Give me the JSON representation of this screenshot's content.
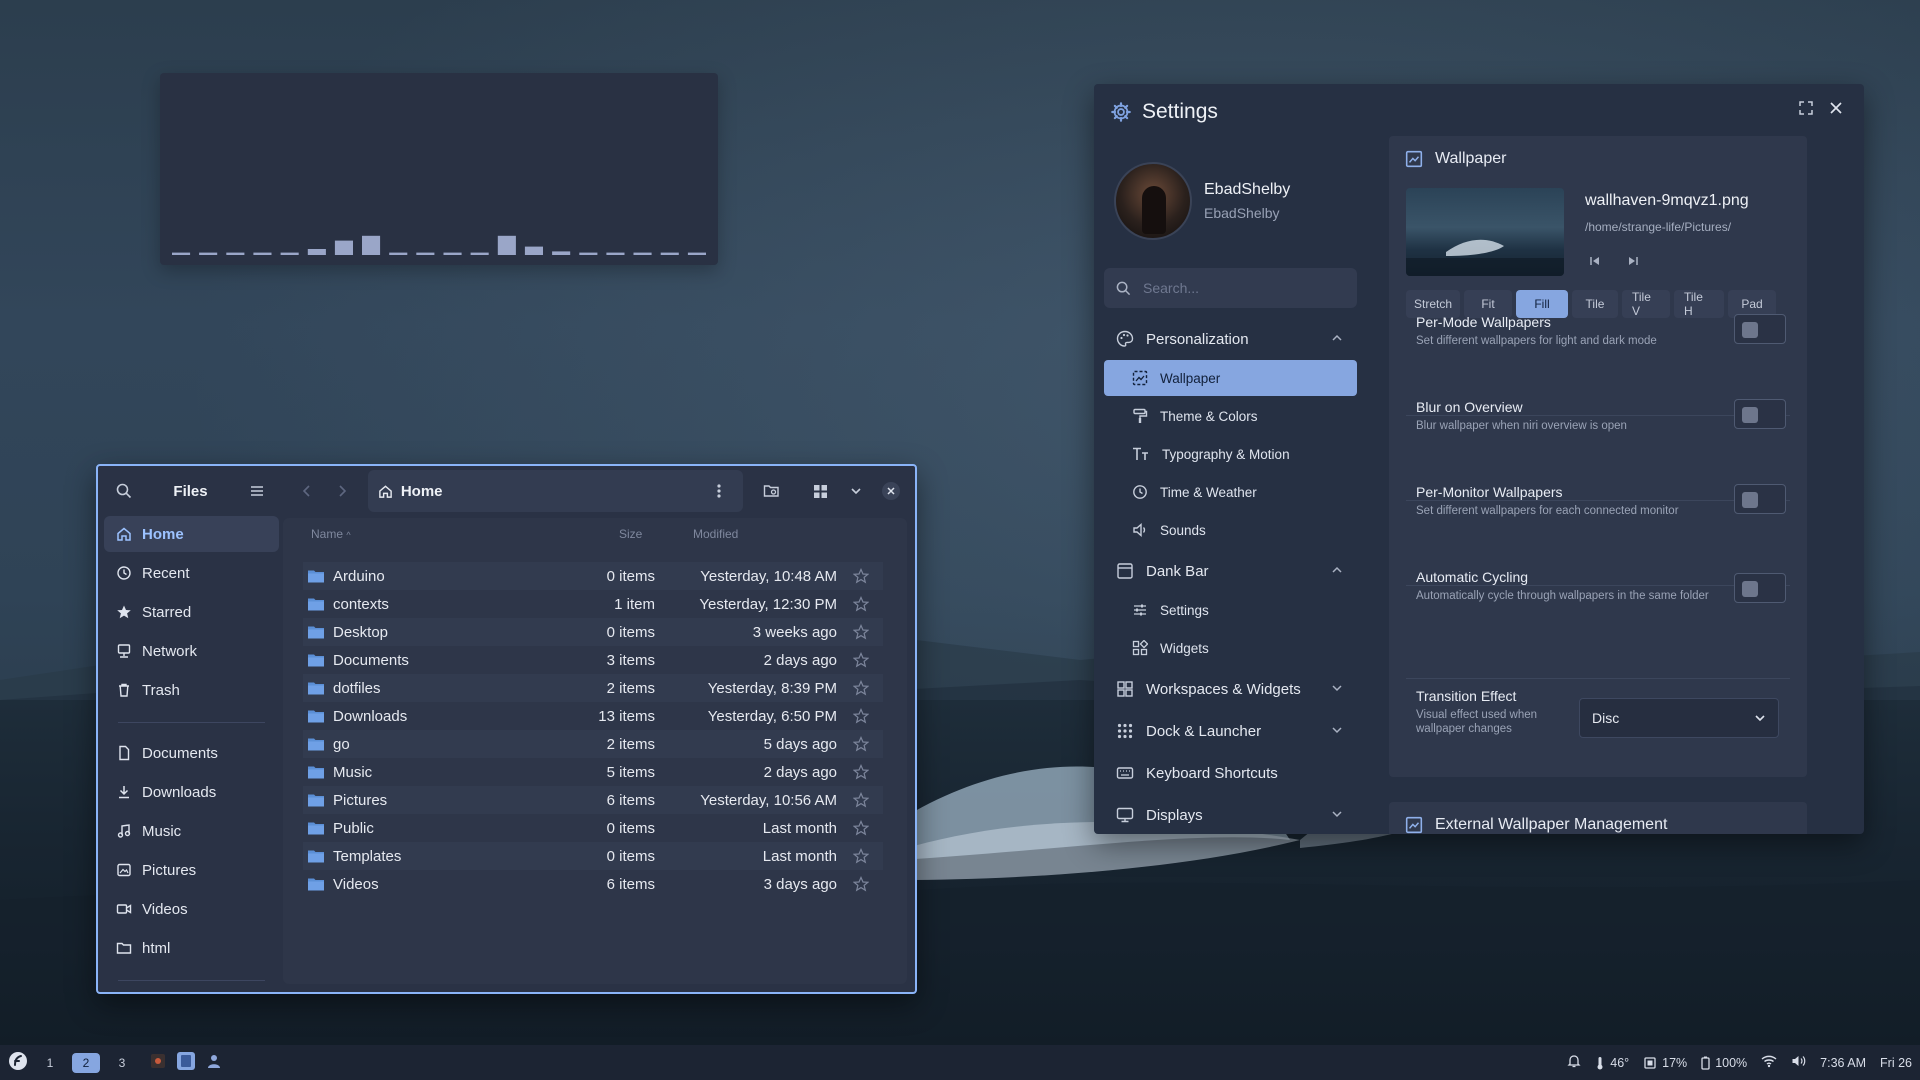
{
  "files": {
    "title": "Files",
    "path": "Home",
    "columns": {
      "name": "Name",
      "size": "Size",
      "modified": "Modified"
    },
    "sidebar": [
      {
        "label": "Home",
        "icon": "home-icon",
        "active": true
      },
      {
        "label": "Recent",
        "icon": "clock-icon"
      },
      {
        "label": "Starred",
        "icon": "star-icon"
      },
      {
        "label": "Network",
        "icon": "network-icon"
      },
      {
        "label": "Trash",
        "icon": "trash-icon"
      }
    ],
    "bookmarks": [
      {
        "label": "Documents",
        "icon": "document-icon"
      },
      {
        "label": "Downloads",
        "icon": "download-icon"
      },
      {
        "label": "Music",
        "icon": "music-icon"
      },
      {
        "label": "Pictures",
        "icon": "picture-icon"
      },
      {
        "label": "Videos",
        "icon": "video-icon"
      },
      {
        "label": "html",
        "icon": "folder-icon"
      }
    ],
    "rows": [
      {
        "name": "Arduino",
        "size": "0 items",
        "modified": "Yesterday, 10:48 AM"
      },
      {
        "name": "contexts",
        "size": "1 item",
        "modified": "Yesterday, 12:30 PM"
      },
      {
        "name": "Desktop",
        "size": "0 items",
        "modified": "3 weeks ago"
      },
      {
        "name": "Documents",
        "size": "3 items",
        "modified": "2 days ago"
      },
      {
        "name": "dotfiles",
        "size": "2 items",
        "modified": "Yesterday, 8:39 PM"
      },
      {
        "name": "Downloads",
        "size": "13 items",
        "modified": "Yesterday, 6:50 PM"
      },
      {
        "name": "go",
        "size": "2 items",
        "modified": "5 days ago"
      },
      {
        "name": "Music",
        "size": "5 items",
        "modified": "2 days ago"
      },
      {
        "name": "Pictures",
        "size": "6 items",
        "modified": "Yesterday, 10:56 AM"
      },
      {
        "name": "Public",
        "size": "0 items",
        "modified": "Last month"
      },
      {
        "name": "Templates",
        "size": "0 items",
        "modified": "Last month"
      },
      {
        "name": "Videos",
        "size": "6 items",
        "modified": "3 days ago"
      }
    ]
  },
  "visualizer": {
    "levels": [
      0.02,
      0.02,
      0.02,
      0.02,
      0.02,
      0.05,
      0.12,
      0.16,
      0.02,
      0.02,
      0.02,
      0.02,
      0.16,
      0.07,
      0.03,
      0.02,
      0.02,
      0.02,
      0.02,
      0.02
    ],
    "color": "#9aa6c8"
  },
  "settings": {
    "title": "Settings",
    "user": {
      "name": "EbadShelby",
      "username": "EbadShelby"
    },
    "search_placeholder": "Search...",
    "nav": {
      "personalization": "Personalization",
      "wallpaper": "Wallpaper",
      "theme": "Theme & Colors",
      "typography": "Typography & Motion",
      "time": "Time & Weather",
      "sounds": "Sounds",
      "dankbar": "Dank Bar",
      "bar_settings": "Settings",
      "widgets": "Widgets",
      "workspaces": "Workspaces & Widgets",
      "dock": "Dock & Launcher",
      "keyboard": "Keyboard Shortcuts",
      "displays": "Displays"
    },
    "wallpaper": {
      "header": "Wallpaper",
      "filename": "wallhaven-9mqvz1.png",
      "path": "/home/strange-life/Pictures/",
      "modes": [
        "Stretch",
        "Fit",
        "Fill",
        "Tile",
        "Tile V",
        "Tile H",
        "Pad"
      ],
      "active_mode": "Fill",
      "options": [
        {
          "title": "Per-Mode Wallpapers",
          "desc": "Set different wallpapers for light and dark mode",
          "enabled": false
        },
        {
          "title": "Blur on Overview",
          "desc": "Blur wallpaper when niri overview is open",
          "enabled": false
        },
        {
          "title": "Per-Monitor Wallpapers",
          "desc": "Set different wallpapers for each connected monitor",
          "enabled": false
        },
        {
          "title": "Automatic Cycling",
          "desc": "Automatically cycle through wallpapers in the same folder",
          "enabled": false
        }
      ],
      "transition": {
        "title": "Transition Effect",
        "desc": "Visual effect used when wallpaper changes",
        "value": "Disc"
      }
    },
    "external": {
      "header": "External Wallpaper Management"
    }
  },
  "taskbar": {
    "workspaces": [
      "1",
      "2",
      "3"
    ],
    "active_workspace": "2",
    "temperature": "46°",
    "cpu": "17%",
    "battery": "100%",
    "time": "7:36 AM",
    "date": "Fri 26"
  },
  "colors": {
    "accent": "#86a6e0",
    "focus_border": "#8ab4f8",
    "folder": "#5b8fd6"
  }
}
